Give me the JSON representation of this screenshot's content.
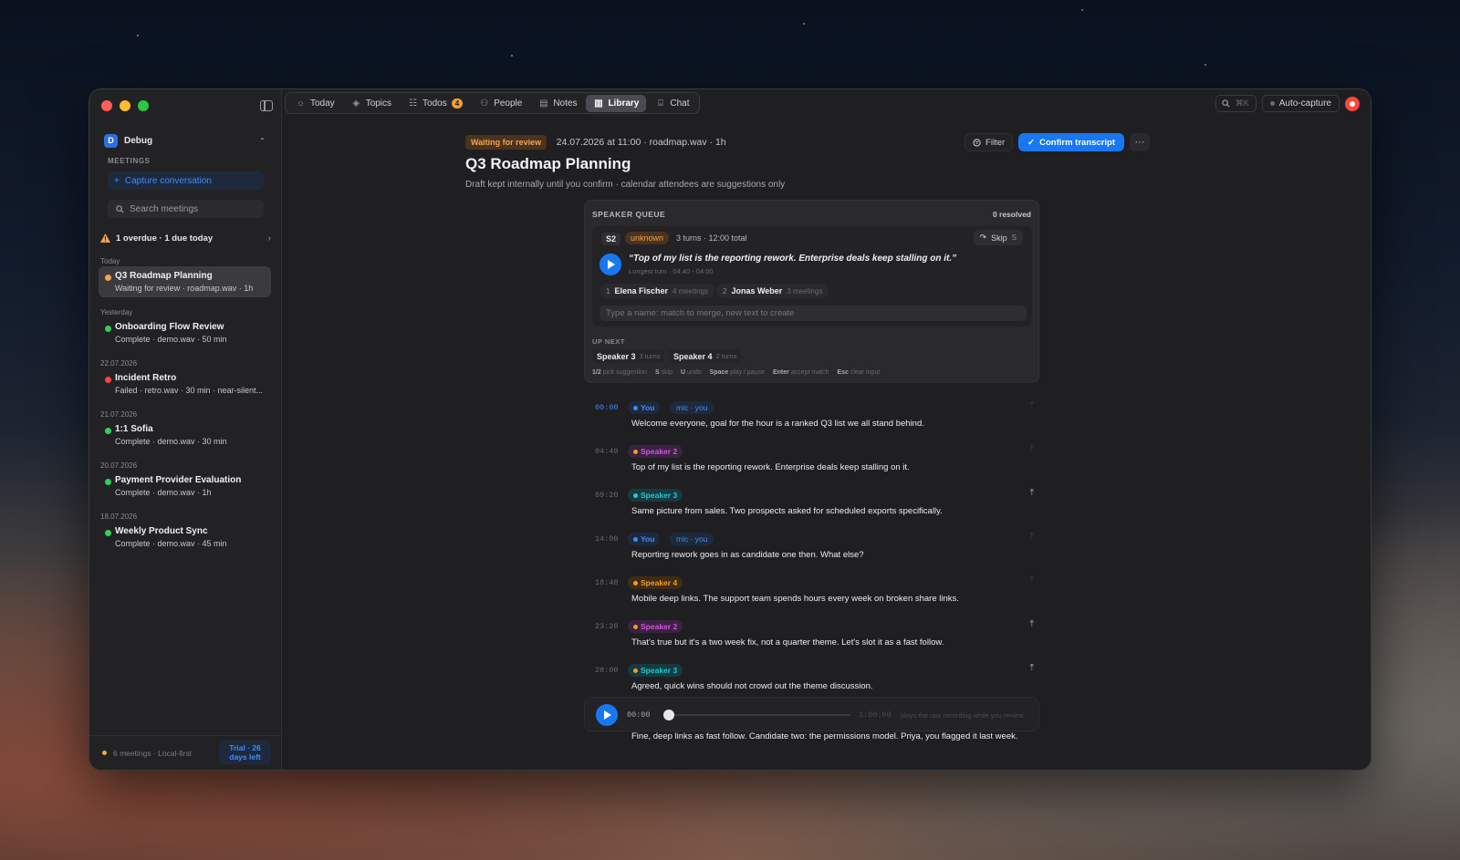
{
  "colors": {
    "accent": "#1878f3",
    "warning": "#f3a44a",
    "complete": "#30d158",
    "failed": "#ff453a",
    "speaker2": "#d74fe6",
    "speaker3": "#1fc9d8",
    "speaker4": "#f39a2a",
    "you": "#3d8bff"
  },
  "sidebar": {
    "workspace": {
      "badge": "D",
      "name": "Debug"
    },
    "section_label": "MEETINGS",
    "capture_label": "Capture conversation",
    "search_placeholder": "Search meetings",
    "alert": "1 overdue · 1 due today",
    "groups": [
      {
        "label": "Today",
        "meetings": [
          {
            "title": "Q3 Roadmap Planning",
            "sub": "Waiting for review · roadmap.wav · 1h",
            "status": "warning"
          }
        ]
      },
      {
        "label": "Yesterday",
        "meetings": [
          {
            "title": "Onboarding Flow Review",
            "sub": "Complete · demo.wav · 50 min",
            "status": "complete"
          }
        ]
      },
      {
        "label": "22.07.2026",
        "meetings": [
          {
            "title": "Incident Retro",
            "sub": "Failed · retro.wav · 30 min · near-silent...",
            "status": "failed"
          }
        ]
      },
      {
        "label": "21.07.2026",
        "meetings": [
          {
            "title": "1:1 Sofia",
            "sub": "Complete · demo.wav · 30 min",
            "status": "complete"
          }
        ]
      },
      {
        "label": "20.07.2026",
        "meetings": [
          {
            "title": "Payment Provider Evaluation",
            "sub": "Complete · demo.wav · 1h",
            "status": "complete"
          }
        ]
      },
      {
        "label": "18.07.2026",
        "meetings": [
          {
            "title": "Weekly Product Sync",
            "sub": "Complete · demo.wav · 45 min",
            "status": "complete"
          }
        ]
      }
    ],
    "footer": {
      "text": "6 meetings · Local-first",
      "trial_line1": "Trial · 26",
      "trial_line2": "days left"
    }
  },
  "nav": {
    "items": [
      {
        "label": "Today",
        "icon": "sun-icon"
      },
      {
        "label": "Topics",
        "icon": "layers-icon"
      },
      {
        "label": "Todos",
        "icon": "checklist-icon",
        "badge": "4"
      },
      {
        "label": "People",
        "icon": "people-icon"
      },
      {
        "label": "Notes",
        "icon": "note-icon"
      },
      {
        "label": "Library",
        "icon": "library-icon",
        "active": true
      },
      {
        "label": "Chat",
        "icon": "chat-icon"
      }
    ],
    "search_shortcut": "⌘K",
    "auto_capture": "Auto-capture"
  },
  "header": {
    "status": "Waiting for review",
    "meta": "24.07.2026 at 11:00 · roadmap.wav · 1h",
    "title": "Q3 Roadmap Planning",
    "subtitle": "Draft kept internally until you confirm · calendar attendees are suggestions only",
    "filter_label": "Filter",
    "confirm_label": "Confirm transcript",
    "more_label": "···"
  },
  "queue": {
    "heading": "SPEAKER QUEUE",
    "resolved": "0 resolved",
    "speaker_id": "S2",
    "speaker_status": "unknown",
    "turns_summary": "3 turns · 12:00 total",
    "skip_label": "Skip",
    "skip_key": "S",
    "quote": "“Top of my list is the reporting rework. Enterprise deals keep stalling on it.”",
    "longest_turn": "Longest turn · 04:40 - 04:00",
    "suggestions": [
      {
        "num": "1",
        "name": "Elena Fischer",
        "meetings": "4 meetings"
      },
      {
        "num": "2",
        "name": "Jonas Weber",
        "meetings": "3 meetings"
      }
    ],
    "name_placeholder": "Type a name: match to merge, new text to create",
    "up_next_label": "UP NEXT",
    "up_next": [
      {
        "name": "Speaker 3",
        "turns": "3 turns"
      },
      {
        "name": "Speaker 4",
        "turns": "2 turns"
      }
    ],
    "hints": [
      {
        "key": "1/2",
        "text": "pick suggestion"
      },
      {
        "key": "S",
        "text": "skip"
      },
      {
        "key": "U",
        "text": "undo"
      },
      {
        "key": "Space",
        "text": "play / pause"
      },
      {
        "key": "Enter",
        "text": "accept match"
      },
      {
        "key": "Esc",
        "text": "clear input"
      }
    ]
  },
  "transcript": [
    {
      "time": "00:00",
      "speaker": "You",
      "mic": "mic · you",
      "text": "Welcome everyone, goal for the hour is a ranked Q3 list we all stand behind.",
      "speaker_color": "you",
      "pinned": false,
      "active": true
    },
    {
      "time": "04:40",
      "speaker": "Speaker 2",
      "text": "Top of my list is the reporting rework. Enterprise deals keep stalling on it.",
      "speaker_color": "speaker2",
      "pinned": false
    },
    {
      "time": "09:20",
      "speaker": "Speaker 3",
      "text": "Same picture from sales. Two prospects asked for scheduled exports specifically.",
      "speaker_color": "speaker3",
      "pinned": true
    },
    {
      "time": "14:00",
      "speaker": "You",
      "mic": "mic · you",
      "text": "Reporting rework goes in as candidate one then. What else?",
      "speaker_color": "you",
      "pinned": false
    },
    {
      "time": "18:40",
      "speaker": "Speaker 4",
      "text": "Mobile deep links. The support team spends hours every week on broken share links.",
      "speaker_color": "speaker4",
      "pinned": false
    },
    {
      "time": "23:20",
      "speaker": "Speaker 2",
      "text": "That's true but it's a two week fix, not a quarter theme. Let's slot it as a fast follow.",
      "speaker_color": "speaker2",
      "pinned": true
    },
    {
      "time": "28:00",
      "speaker": "Speaker 3",
      "text": "Agreed, quick wins should not crowd out the theme discussion.",
      "speaker_color": "speaker3",
      "pinned": true
    }
  ],
  "player": {
    "current": "00:00",
    "total": "1:00:00",
    "hint": "plays the raw recording while you review",
    "progress": 0
  },
  "tail_text": "Fine, deep links as fast follow. Candidate two: the permissions model. Priya, you flagged it last week."
}
